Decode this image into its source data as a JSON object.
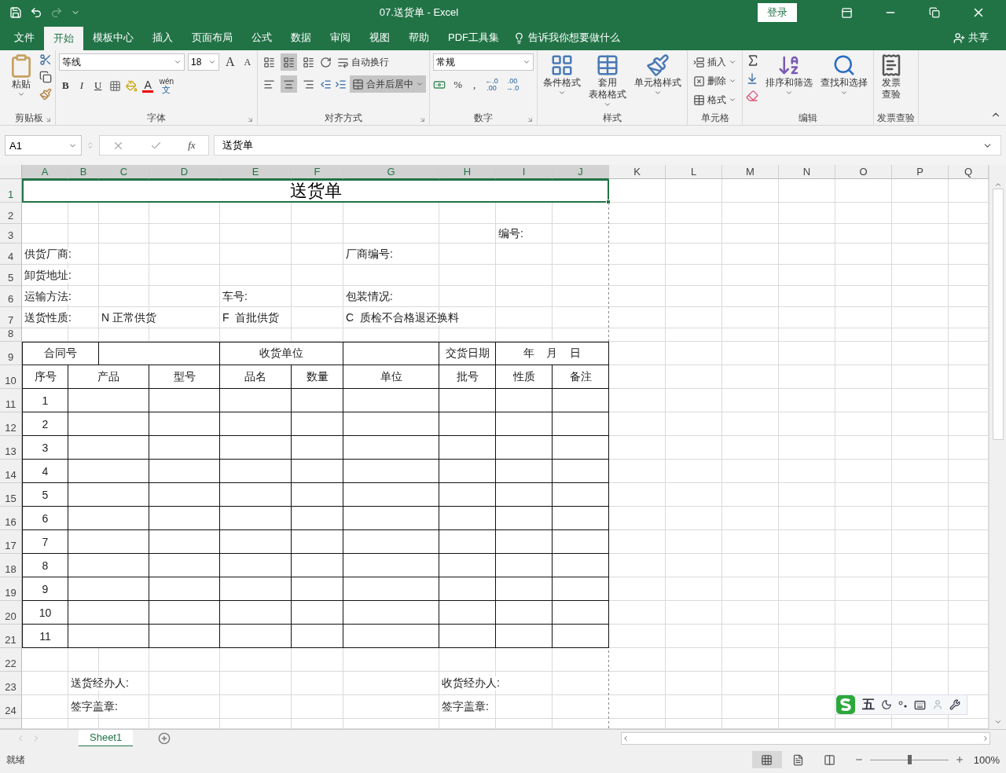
{
  "title_bar": {
    "title": "07.送货单  -  Excel",
    "login": "登录"
  },
  "menu": {
    "tabs": [
      {
        "label": "文件",
        "selected": false
      },
      {
        "label": "开始",
        "selected": true
      },
      {
        "label": "模板中心",
        "selected": false
      },
      {
        "label": "插入",
        "selected": false
      },
      {
        "label": "页面布局",
        "selected": false
      },
      {
        "label": "公式",
        "selected": false
      },
      {
        "label": "数据",
        "selected": false
      },
      {
        "label": "审阅",
        "selected": false
      },
      {
        "label": "视图",
        "selected": false
      },
      {
        "label": "帮助",
        "selected": false
      },
      {
        "label": "PDF工具集",
        "selected": false
      }
    ],
    "tell_me": "告诉我你想要做什么",
    "share": "共享"
  },
  "ribbon": {
    "groups": [
      {
        "kind": "clipboard",
        "label": "剪贴板",
        "paste": "粘贴"
      },
      {
        "kind": "font",
        "label": "字体",
        "font": "等线",
        "size": "18",
        "grow": "A",
        "shrink": "A",
        "bold": "B",
        "italic": "I",
        "underline": "U",
        "font_color": "A",
        "phonetic": "wén",
        "phonetic_char": "文"
      },
      {
        "kind": "alignment",
        "label": "对齐方式",
        "wrap": "自动换行",
        "merge": "合并后居中",
        "vertical": [
          {
            "selected": false
          },
          {
            "selected": true
          },
          {
            "selected": false
          }
        ],
        "horizontal": [
          {
            "selected": false
          },
          {
            "selected": true
          },
          {
            "selected": false
          }
        ]
      },
      {
        "kind": "number",
        "label": "数字",
        "format": "常规",
        "percent": "%",
        "comma": ",",
        "increase_decimal": [
          "←.0",
          ".00"
        ],
        "decrease_decimal": [
          ".00",
          "→.0"
        ]
      },
      {
        "kind": "styles",
        "label": "样式",
        "buttons": [
          [
            "条件格式"
          ],
          [
            "套用",
            "表格格式"
          ],
          [
            "单元格样式"
          ]
        ]
      },
      {
        "kind": "cells",
        "label": "单元格",
        "buttons": [
          "插入",
          "删除",
          "格式"
        ]
      },
      {
        "kind": "editing",
        "label": "编辑",
        "buttons": [
          "排序和筛选",
          "查找和选择"
        ]
      },
      {
        "kind": "invoice",
        "label": "发票查验",
        "button": [
          "发票",
          "查验"
        ]
      }
    ]
  },
  "formula_bar": {
    "name_box": "A1",
    "fx": "fx",
    "value": "送货单"
  },
  "sheet": {
    "columns": [
      "A",
      "B",
      "C",
      "D",
      "E",
      "F",
      "G",
      "H",
      "I",
      "J",
      "K",
      "L",
      "M",
      "N",
      "O",
      "P",
      "Q"
    ],
    "rows": [
      "1",
      "2",
      "3",
      "4",
      "5",
      "6",
      "7",
      "8",
      "9",
      "10",
      "11",
      "12",
      "13",
      "14",
      "15",
      "16",
      "17",
      "18",
      "19",
      "20",
      "21",
      "22",
      "23",
      "24"
    ],
    "title": {
      "text": "送货单",
      "selected": true
    },
    "texts": [
      "编号:",
      "供货厂商:",
      "厂商编号:",
      "卸货地址:",
      "运输方法:",
      "车号:",
      "包装情况:",
      "送货性质:",
      "N 正常供货",
      "F  首批供货",
      "C  质检不合格退还换料",
      "送货经办人:",
      "收货经办人:",
      "签字盖章:",
      "签字盖章:"
    ],
    "table": {
      "info_row": [
        "合同号",
        "收货单位",
        "交货日期",
        "年    月    日"
      ],
      "header_row": [
        "序号",
        "产品",
        "型号",
        "品名",
        "数量",
        "单位",
        "批号",
        "性质",
        "备注"
      ],
      "numbers": [
        "1",
        "2",
        "3",
        "4",
        "5",
        "6",
        "7",
        "8",
        "9",
        "10",
        "11"
      ]
    }
  },
  "sheet_tabs": [
    {
      "label": "Sheet1",
      "selected": true
    }
  ],
  "ime_toolbar": {
    "mode": "五"
  },
  "status_bar": {
    "status": "就绪",
    "views": [
      {
        "selected": true
      },
      {
        "selected": false
      },
      {
        "selected": false
      }
    ],
    "zoom": {
      "level": 0.5
    },
    "zoom_text": "100%"
  }
}
